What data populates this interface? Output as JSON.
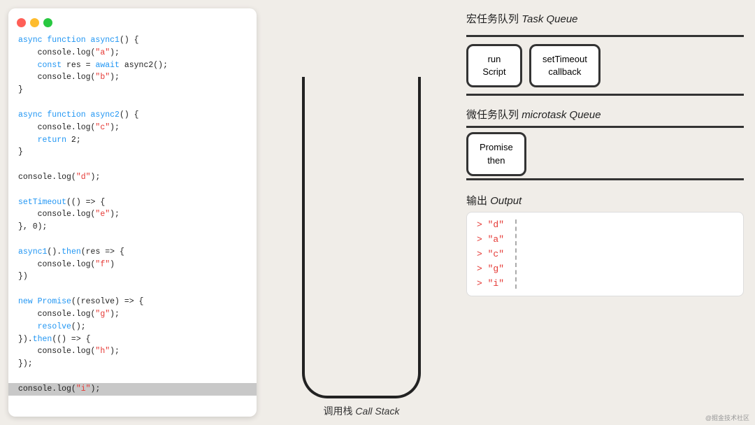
{
  "traffic_lights": {
    "red": "#ff5f57",
    "yellow": "#febc2e",
    "green": "#28c840"
  },
  "code": {
    "lines": [
      {
        "text": "async function async1() {",
        "type": "normal",
        "kw_parts": [
          {
            "text": "async function ",
            "color": "blue"
          },
          {
            "text": "async1",
            "color": "blue"
          },
          {
            "text": "() {",
            "color": "normal"
          }
        ]
      },
      {
        "text": "    console.log(\"a\");",
        "type": "str"
      },
      {
        "text": "    const res = await async2();",
        "type": "mixed"
      },
      {
        "text": "    console.log(\"b\");",
        "type": "str"
      },
      {
        "text": "}",
        "type": "normal"
      },
      {
        "text": "",
        "type": "normal"
      },
      {
        "text": "async function async2() {",
        "type": "mixed"
      },
      {
        "text": "    console.log(\"c\");",
        "type": "str"
      },
      {
        "text": "    return 2;",
        "type": "normal"
      },
      {
        "text": "}",
        "type": "normal"
      },
      {
        "text": "",
        "type": "normal"
      },
      {
        "text": "console.log(\"d\");",
        "type": "str"
      },
      {
        "text": "",
        "type": "normal"
      },
      {
        "text": "setTimeout(() => {",
        "type": "mixed"
      },
      {
        "text": "    console.log(\"e\");",
        "type": "str"
      },
      {
        "text": "}, 0);",
        "type": "normal"
      },
      {
        "text": "",
        "type": "normal"
      },
      {
        "text": "async1().then(res => {",
        "type": "mixed"
      },
      {
        "text": "    console.log(\"f\")",
        "type": "str"
      },
      {
        "text": "})",
        "type": "normal"
      },
      {
        "text": "",
        "type": "normal"
      },
      {
        "text": "new Promise((resolve) => {",
        "type": "mixed"
      },
      {
        "text": "    console.log(\"g\");",
        "type": "str"
      },
      {
        "text": "    resolve();",
        "type": "mixed"
      },
      {
        "text": "}).then(() => {",
        "type": "mixed"
      },
      {
        "text": "    console.log(\"h\");",
        "type": "str"
      },
      {
        "text": "});",
        "type": "normal"
      },
      {
        "text": "",
        "type": "normal"
      },
      {
        "text": "console.log(\"i\");",
        "type": "highlighted"
      }
    ]
  },
  "callstack": {
    "label": "调用栈",
    "label_italic": "Call Stack"
  },
  "task_queue": {
    "title": "宏任务队列",
    "title_italic": "Task Queue",
    "items": [
      {
        "line1": "run",
        "line2": "Script"
      },
      {
        "line1": "setTimeout",
        "line2": "callback"
      }
    ]
  },
  "microtask_queue": {
    "title": "微任务队列",
    "title_italic": "microtask Queue",
    "items": [
      {
        "line1": "Promise",
        "line2": "then"
      }
    ]
  },
  "output": {
    "title": "输出",
    "title_italic": "Output",
    "items": [
      "> \"d\"",
      "> \"a\"",
      "> \"c\"",
      "> \"g\"",
      "> \"i\""
    ]
  },
  "watermark": "@掘金技术社区"
}
